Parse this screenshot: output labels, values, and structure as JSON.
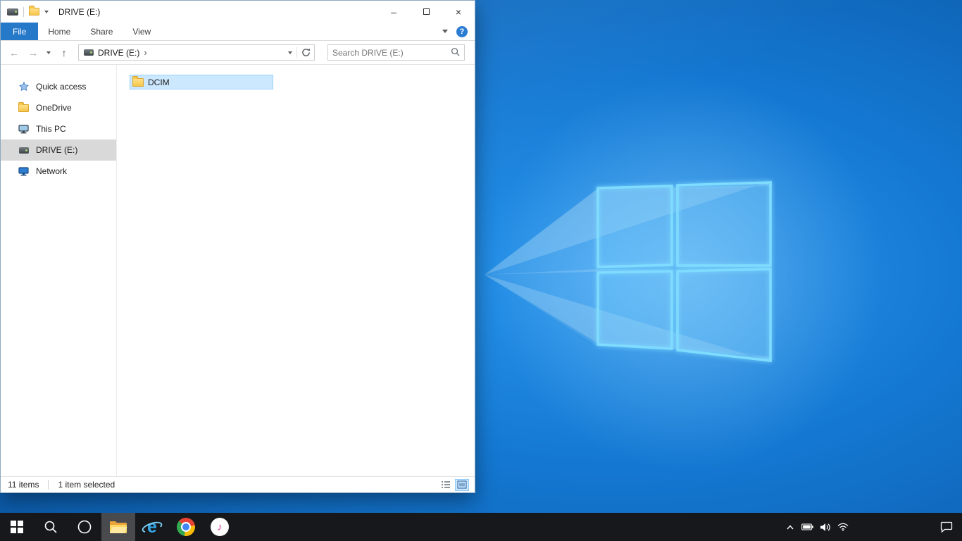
{
  "explorer": {
    "title": "DRIVE (E:)",
    "window_controls": {
      "minimize": "–",
      "close": "×"
    },
    "ribbon": {
      "tabs": [
        {
          "label": "File"
        },
        {
          "label": "Home"
        },
        {
          "label": "Share"
        },
        {
          "label": "View"
        }
      ],
      "help_glyph": "?"
    },
    "nav": {
      "back_glyph": "←",
      "forward_glyph": "→",
      "up_glyph": "↑",
      "breadcrumb": [
        {
          "label": "DRIVE (E:)"
        }
      ],
      "crumb_sep": "›",
      "search_placeholder": "Search DRIVE (E:)"
    },
    "sidebar": {
      "items": [
        {
          "label": "Quick access",
          "icon": "star-icon"
        },
        {
          "label": "OneDrive",
          "icon": "folder-icon"
        },
        {
          "label": "This PC",
          "icon": "monitor-icon"
        },
        {
          "label": "DRIVE (E:)",
          "icon": "drive-icon",
          "selected": true
        },
        {
          "label": "Network",
          "icon": "network-icon"
        }
      ]
    },
    "files": [
      {
        "name": "DCIM",
        "icon": "folder-icon",
        "selected": true
      }
    ],
    "status": {
      "items": "11 items",
      "selection": "1 item selected"
    }
  },
  "taskbar": {
    "ie_glyph": "e",
    "itunes_glyph": "♪",
    "icons": [
      "start",
      "search",
      "cortana",
      "file-explorer",
      "internet-explorer",
      "chrome",
      "itunes"
    ],
    "active_icon": "file-explorer",
    "tray": [
      "hidden-icons-chevron",
      "battery",
      "volume",
      "network",
      "action-center"
    ]
  },
  "colors": {
    "file_tab_blue": "#2678c9",
    "help_blue": "#2b7cd3",
    "selection_fill": "#cce8ff",
    "selection_border": "#99d1ff",
    "sidebar_selected": "#d9d9d9",
    "folder_yellow": "#f7c64a",
    "taskbar_bg": "#16181b",
    "wallpaper_base": "#0b5aa5",
    "logo_stroke": "#7fdcff"
  }
}
